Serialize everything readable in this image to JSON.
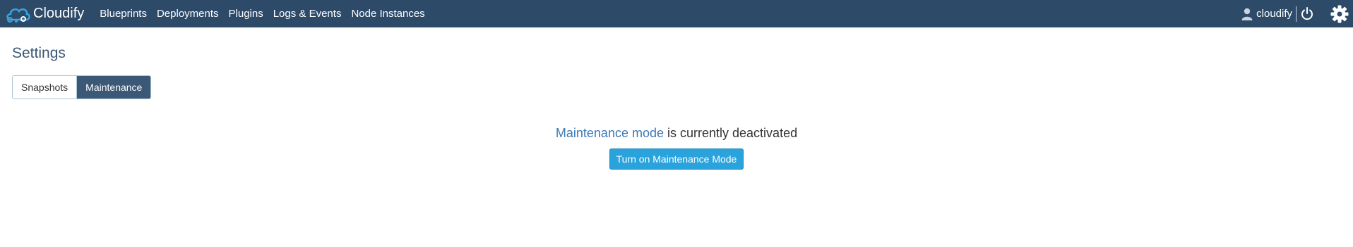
{
  "brand": {
    "name": "Cloudify"
  },
  "nav": {
    "items": [
      {
        "label": "Blueprints"
      },
      {
        "label": "Deployments"
      },
      {
        "label": "Plugins"
      },
      {
        "label": "Logs & Events"
      },
      {
        "label": "Node Instances"
      }
    ]
  },
  "user": {
    "name": "cloudify"
  },
  "icons": {
    "user": "user-icon",
    "logout": "power-icon",
    "settings": "gear-icon"
  },
  "page": {
    "title": "Settings"
  },
  "tabs": [
    {
      "label": "Snapshots",
      "active": false
    },
    {
      "label": "Maintenance",
      "active": true
    }
  ],
  "maintenance": {
    "mode_label": "Maintenance mode",
    "status_text": " is currently deactivated",
    "button_label": "Turn on Maintenance Mode"
  },
  "colors": {
    "topbar": "#2d4a69",
    "accent": "#3b5876",
    "button": "#2aa3dd",
    "link": "#3d7ab8"
  }
}
